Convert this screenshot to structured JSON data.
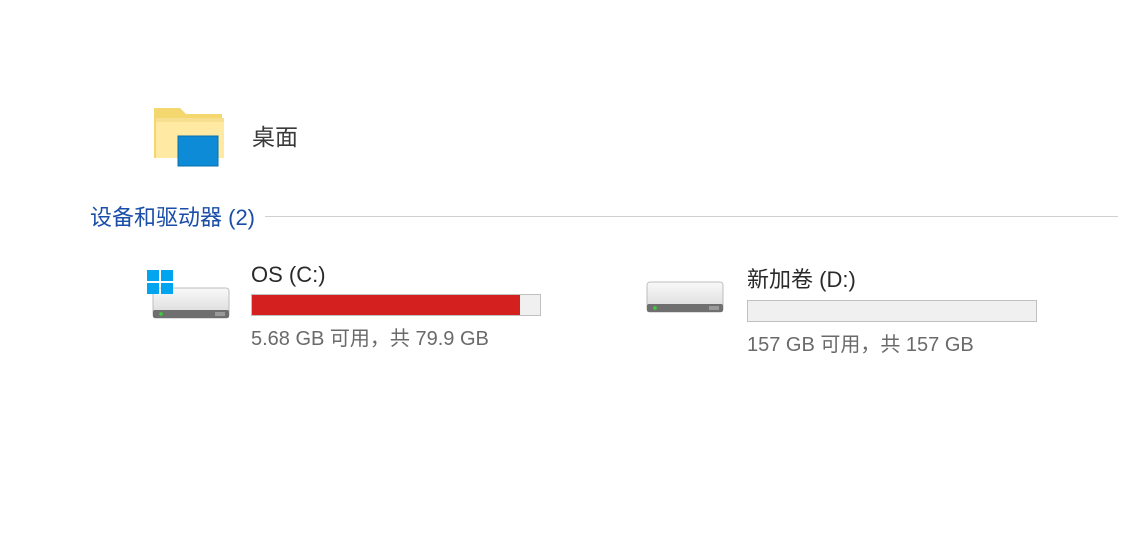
{
  "folder": {
    "label": "桌面"
  },
  "section": {
    "title": "设备和驱动器 (2)"
  },
  "drives": [
    {
      "name": "OS (C:)",
      "status": "5.68 GB 可用，共 79.9 GB",
      "fill_percent": 93,
      "fill_color": "red",
      "is_system": true
    },
    {
      "name": "新加卷 (D:)",
      "status": "157 GB 可用，共 157 GB",
      "fill_percent": 0,
      "fill_color": "blue",
      "is_system": false
    }
  ]
}
